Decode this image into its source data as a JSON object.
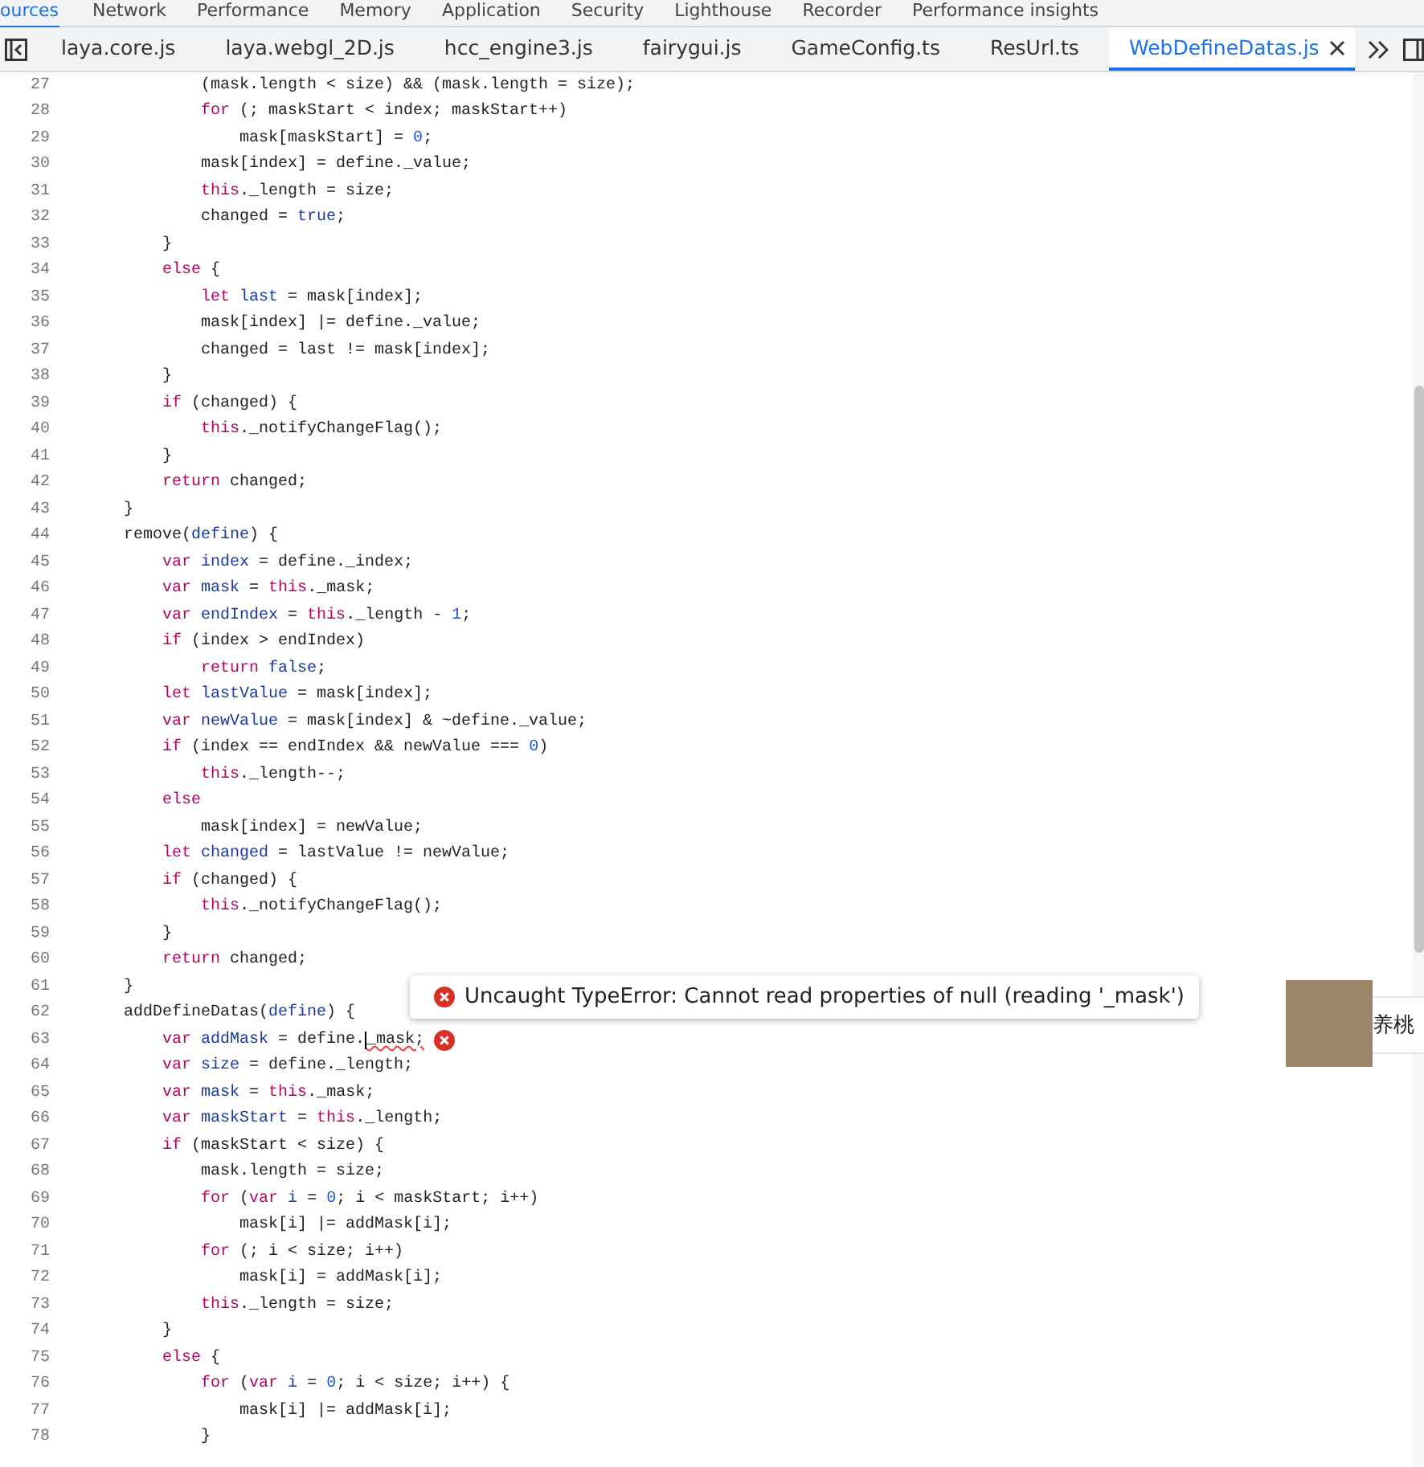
{
  "panel_tabs": [
    {
      "label": "ources",
      "selected": true
    },
    {
      "label": "Network",
      "selected": false
    },
    {
      "label": "Performance",
      "selected": false
    },
    {
      "label": "Memory",
      "selected": false
    },
    {
      "label": "Application",
      "selected": false
    },
    {
      "label": "Security",
      "selected": false
    },
    {
      "label": "Lighthouse",
      "selected": false
    },
    {
      "label": "Recorder",
      "selected": false
    },
    {
      "label": "Performance insights",
      "selected": false
    }
  ],
  "file_tabs": [
    {
      "label": "laya.core.js",
      "selected": false
    },
    {
      "label": "laya.webgl_2D.js",
      "selected": false
    },
    {
      "label": "hcc_engine3.js",
      "selected": false
    },
    {
      "label": "fairygui.js",
      "selected": false
    },
    {
      "label": "GameConfig.ts",
      "selected": false
    },
    {
      "label": "ResUrl.ts",
      "selected": false
    },
    {
      "label": "WebDefineDatas.js",
      "selected": true
    }
  ],
  "editor": {
    "lines": [
      {
        "number": "27",
        "segments": [
          {
            "text": "            (mask.length < size) && (mask.length = size);",
            "kind": "plain"
          }
        ]
      },
      {
        "number": "28",
        "segments": [
          {
            "text": "            for",
            "kind": "keyword"
          },
          {
            "text": " (; maskStart < index; maskStart++)",
            "kind": "plain"
          }
        ]
      },
      {
        "number": "29",
        "segments": [
          {
            "text": "                mask[maskStart] = ",
            "kind": "plain"
          },
          {
            "text": "0",
            "kind": "number"
          },
          {
            "text": ";",
            "kind": "plain"
          }
        ]
      },
      {
        "number": "30",
        "segments": [
          {
            "text": "            mask[index] = define._value;",
            "kind": "plain"
          }
        ]
      },
      {
        "number": "31",
        "segments": [
          {
            "text": "            this",
            "kind": "keyword"
          },
          {
            "text": "._length = size;",
            "kind": "plain"
          }
        ]
      },
      {
        "number": "32",
        "segments": [
          {
            "text": "            changed = ",
            "kind": "plain"
          },
          {
            "text": "true",
            "kind": "atom"
          },
          {
            "text": ";",
            "kind": "plain"
          }
        ]
      },
      {
        "number": "33",
        "segments": [
          {
            "text": "        }",
            "kind": "plain"
          }
        ]
      },
      {
        "number": "34",
        "segments": [
          {
            "text": "        else",
            "kind": "keyword"
          },
          {
            "text": " {",
            "kind": "plain"
          }
        ]
      },
      {
        "number": "35",
        "segments": [
          {
            "text": "            let",
            "kind": "keyword"
          },
          {
            "text": " last",
            "kind": "definition"
          },
          {
            "text": " = mask[index];",
            "kind": "plain"
          }
        ]
      },
      {
        "number": "36",
        "segments": [
          {
            "text": "            mask[index] |= define._value;",
            "kind": "plain"
          }
        ]
      },
      {
        "number": "37",
        "segments": [
          {
            "text": "            changed = last != mask[index];",
            "kind": "plain"
          }
        ]
      },
      {
        "number": "38",
        "segments": [
          {
            "text": "        }",
            "kind": "plain"
          }
        ]
      },
      {
        "number": "39",
        "segments": [
          {
            "text": "        if",
            "kind": "keyword"
          },
          {
            "text": " (changed) {",
            "kind": "plain"
          }
        ]
      },
      {
        "number": "40",
        "segments": [
          {
            "text": "            this",
            "kind": "keyword"
          },
          {
            "text": "._notifyChangeFlag();",
            "kind": "plain"
          }
        ]
      },
      {
        "number": "41",
        "segments": [
          {
            "text": "        }",
            "kind": "plain"
          }
        ]
      },
      {
        "number": "42",
        "segments": [
          {
            "text": "        return",
            "kind": "keyword"
          },
          {
            "text": " changed;",
            "kind": "plain"
          }
        ]
      },
      {
        "number": "43",
        "segments": [
          {
            "text": "    }",
            "kind": "plain"
          }
        ]
      },
      {
        "number": "44",
        "segments": [
          {
            "text": "    remove(",
            "kind": "plain"
          },
          {
            "text": "define",
            "kind": "definition"
          },
          {
            "text": ") {",
            "kind": "plain"
          }
        ]
      },
      {
        "number": "45",
        "segments": [
          {
            "text": "        var",
            "kind": "keyword"
          },
          {
            "text": " index",
            "kind": "definition"
          },
          {
            "text": " = define._index;",
            "kind": "plain"
          }
        ]
      },
      {
        "number": "46",
        "segments": [
          {
            "text": "        var",
            "kind": "keyword"
          },
          {
            "text": " mask",
            "kind": "definition"
          },
          {
            "text": " = ",
            "kind": "plain"
          },
          {
            "text": "this",
            "kind": "keyword"
          },
          {
            "text": "._mask;",
            "kind": "plain"
          }
        ]
      },
      {
        "number": "47",
        "segments": [
          {
            "text": "        var",
            "kind": "keyword"
          },
          {
            "text": " endIndex",
            "kind": "definition"
          },
          {
            "text": " = ",
            "kind": "plain"
          },
          {
            "text": "this",
            "kind": "keyword"
          },
          {
            "text": "._length - ",
            "kind": "plain"
          },
          {
            "text": "1",
            "kind": "number"
          },
          {
            "text": ";",
            "kind": "plain"
          }
        ]
      },
      {
        "number": "48",
        "segments": [
          {
            "text": "        if",
            "kind": "keyword"
          },
          {
            "text": " (index > endIndex)",
            "kind": "plain"
          }
        ]
      },
      {
        "number": "49",
        "segments": [
          {
            "text": "            return",
            "kind": "keyword"
          },
          {
            "text": " false",
            "kind": "atom"
          },
          {
            "text": ";",
            "kind": "plain"
          }
        ]
      },
      {
        "number": "50",
        "segments": [
          {
            "text": "        let",
            "kind": "keyword"
          },
          {
            "text": " lastValue",
            "kind": "definition"
          },
          {
            "text": " = mask[index];",
            "kind": "plain"
          }
        ]
      },
      {
        "number": "51",
        "segments": [
          {
            "text": "        var",
            "kind": "keyword"
          },
          {
            "text": " newValue",
            "kind": "definition"
          },
          {
            "text": " = mask[index] & ~define._value;",
            "kind": "plain"
          }
        ]
      },
      {
        "number": "52",
        "segments": [
          {
            "text": "        if",
            "kind": "keyword"
          },
          {
            "text": " (index == endIndex && newValue === ",
            "kind": "plain"
          },
          {
            "text": "0",
            "kind": "number"
          },
          {
            "text": ")",
            "kind": "plain"
          }
        ]
      },
      {
        "number": "53",
        "segments": [
          {
            "text": "            this",
            "kind": "keyword"
          },
          {
            "text": "._length--;",
            "kind": "plain"
          }
        ]
      },
      {
        "number": "54",
        "segments": [
          {
            "text": "        else",
            "kind": "keyword"
          }
        ]
      },
      {
        "number": "55",
        "segments": [
          {
            "text": "            mask[index] = newValue;",
            "kind": "plain"
          }
        ]
      },
      {
        "number": "56",
        "segments": [
          {
            "text": "        let",
            "kind": "keyword"
          },
          {
            "text": " changed",
            "kind": "definition"
          },
          {
            "text": " = lastValue != newValue;",
            "kind": "plain"
          }
        ]
      },
      {
        "number": "57",
        "segments": [
          {
            "text": "        if",
            "kind": "keyword"
          },
          {
            "text": " (changed) {",
            "kind": "plain"
          }
        ]
      },
      {
        "number": "58",
        "segments": [
          {
            "text": "            this",
            "kind": "keyword"
          },
          {
            "text": "._notifyChangeFlag();",
            "kind": "plain"
          }
        ]
      },
      {
        "number": "59",
        "segments": [
          {
            "text": "        }",
            "kind": "plain"
          }
        ]
      },
      {
        "number": "60",
        "segments": [
          {
            "text": "        return",
            "kind": "keyword"
          },
          {
            "text": " changed;",
            "kind": "plain"
          }
        ]
      },
      {
        "number": "61",
        "segments": [
          {
            "text": "    }",
            "kind": "plain"
          }
        ]
      },
      {
        "number": "62",
        "segments": [
          {
            "text": "    addDefineDatas(",
            "kind": "plain"
          },
          {
            "text": "define",
            "kind": "definition"
          },
          {
            "text": ") {",
            "kind": "plain"
          }
        ]
      },
      {
        "number": "63",
        "error": true,
        "segments": [
          {
            "text": "        var",
            "kind": "keyword"
          },
          {
            "text": " addMask",
            "kind": "definition"
          },
          {
            "text": " = define.",
            "kind": "plain"
          },
          {
            "text": "_mask;",
            "kind": "error"
          }
        ]
      },
      {
        "number": "64",
        "segments": [
          {
            "text": "        var",
            "kind": "keyword"
          },
          {
            "text": " size",
            "kind": "definition"
          },
          {
            "text": " = define._length;",
            "kind": "plain"
          }
        ]
      },
      {
        "number": "65",
        "segments": [
          {
            "text": "        var",
            "kind": "keyword"
          },
          {
            "text": " mask",
            "kind": "definition"
          },
          {
            "text": " = ",
            "kind": "plain"
          },
          {
            "text": "this",
            "kind": "keyword"
          },
          {
            "text": "._mask;",
            "kind": "plain"
          }
        ]
      },
      {
        "number": "66",
        "segments": [
          {
            "text": "        var",
            "kind": "keyword"
          },
          {
            "text": " maskStart",
            "kind": "definition"
          },
          {
            "text": " = ",
            "kind": "plain"
          },
          {
            "text": "this",
            "kind": "keyword"
          },
          {
            "text": "._length;",
            "kind": "plain"
          }
        ]
      },
      {
        "number": "67",
        "segments": [
          {
            "text": "        if",
            "kind": "keyword"
          },
          {
            "text": " (maskStart < size) {",
            "kind": "plain"
          }
        ]
      },
      {
        "number": "68",
        "segments": [
          {
            "text": "            mask.length = size;",
            "kind": "plain"
          }
        ]
      },
      {
        "number": "69",
        "segments": [
          {
            "text": "            for",
            "kind": "keyword"
          },
          {
            "text": " (",
            "kind": "plain"
          },
          {
            "text": "var",
            "kind": "keyword"
          },
          {
            "text": " i",
            "kind": "definition"
          },
          {
            "text": " = ",
            "kind": "plain"
          },
          {
            "text": "0",
            "kind": "number"
          },
          {
            "text": "; i < maskStart; i++)",
            "kind": "plain"
          }
        ]
      },
      {
        "number": "70",
        "segments": [
          {
            "text": "                mask[i] |= addMask[i];",
            "kind": "plain"
          }
        ]
      },
      {
        "number": "71",
        "segments": [
          {
            "text": "            for",
            "kind": "keyword"
          },
          {
            "text": " (; i < size; i++)",
            "kind": "plain"
          }
        ]
      },
      {
        "number": "72",
        "segments": [
          {
            "text": "                mask[i] = addMask[i];",
            "kind": "plain"
          }
        ]
      },
      {
        "number": "73",
        "segments": [
          {
            "text": "            this",
            "kind": "keyword"
          },
          {
            "text": "._length = size;",
            "kind": "plain"
          }
        ]
      },
      {
        "number": "74",
        "segments": [
          {
            "text": "        }",
            "kind": "plain"
          }
        ]
      },
      {
        "number": "75",
        "segments": [
          {
            "text": "        else",
            "kind": "keyword"
          },
          {
            "text": " {",
            "kind": "plain"
          }
        ]
      },
      {
        "number": "76",
        "segments": [
          {
            "text": "            for",
            "kind": "keyword"
          },
          {
            "text": " (",
            "kind": "plain"
          },
          {
            "text": "var",
            "kind": "keyword"
          },
          {
            "text": " i",
            "kind": "definition"
          },
          {
            "text": " = ",
            "kind": "plain"
          },
          {
            "text": "0",
            "kind": "number"
          },
          {
            "text": "; i < size; i++) {",
            "kind": "plain"
          }
        ]
      },
      {
        "number": "77",
        "segments": [
          {
            "text": "                mask[i] |= addMask[i];",
            "kind": "plain"
          }
        ]
      },
      {
        "number": "78",
        "segments": [
          {
            "text": "            }",
            "kind": "plain"
          }
        ]
      }
    ]
  },
  "error_tooltip": {
    "message": "Uncaught TypeError: Cannot read properties of null (reading '_mask')"
  },
  "floating_widget": {
    "label": "养桃"
  }
}
